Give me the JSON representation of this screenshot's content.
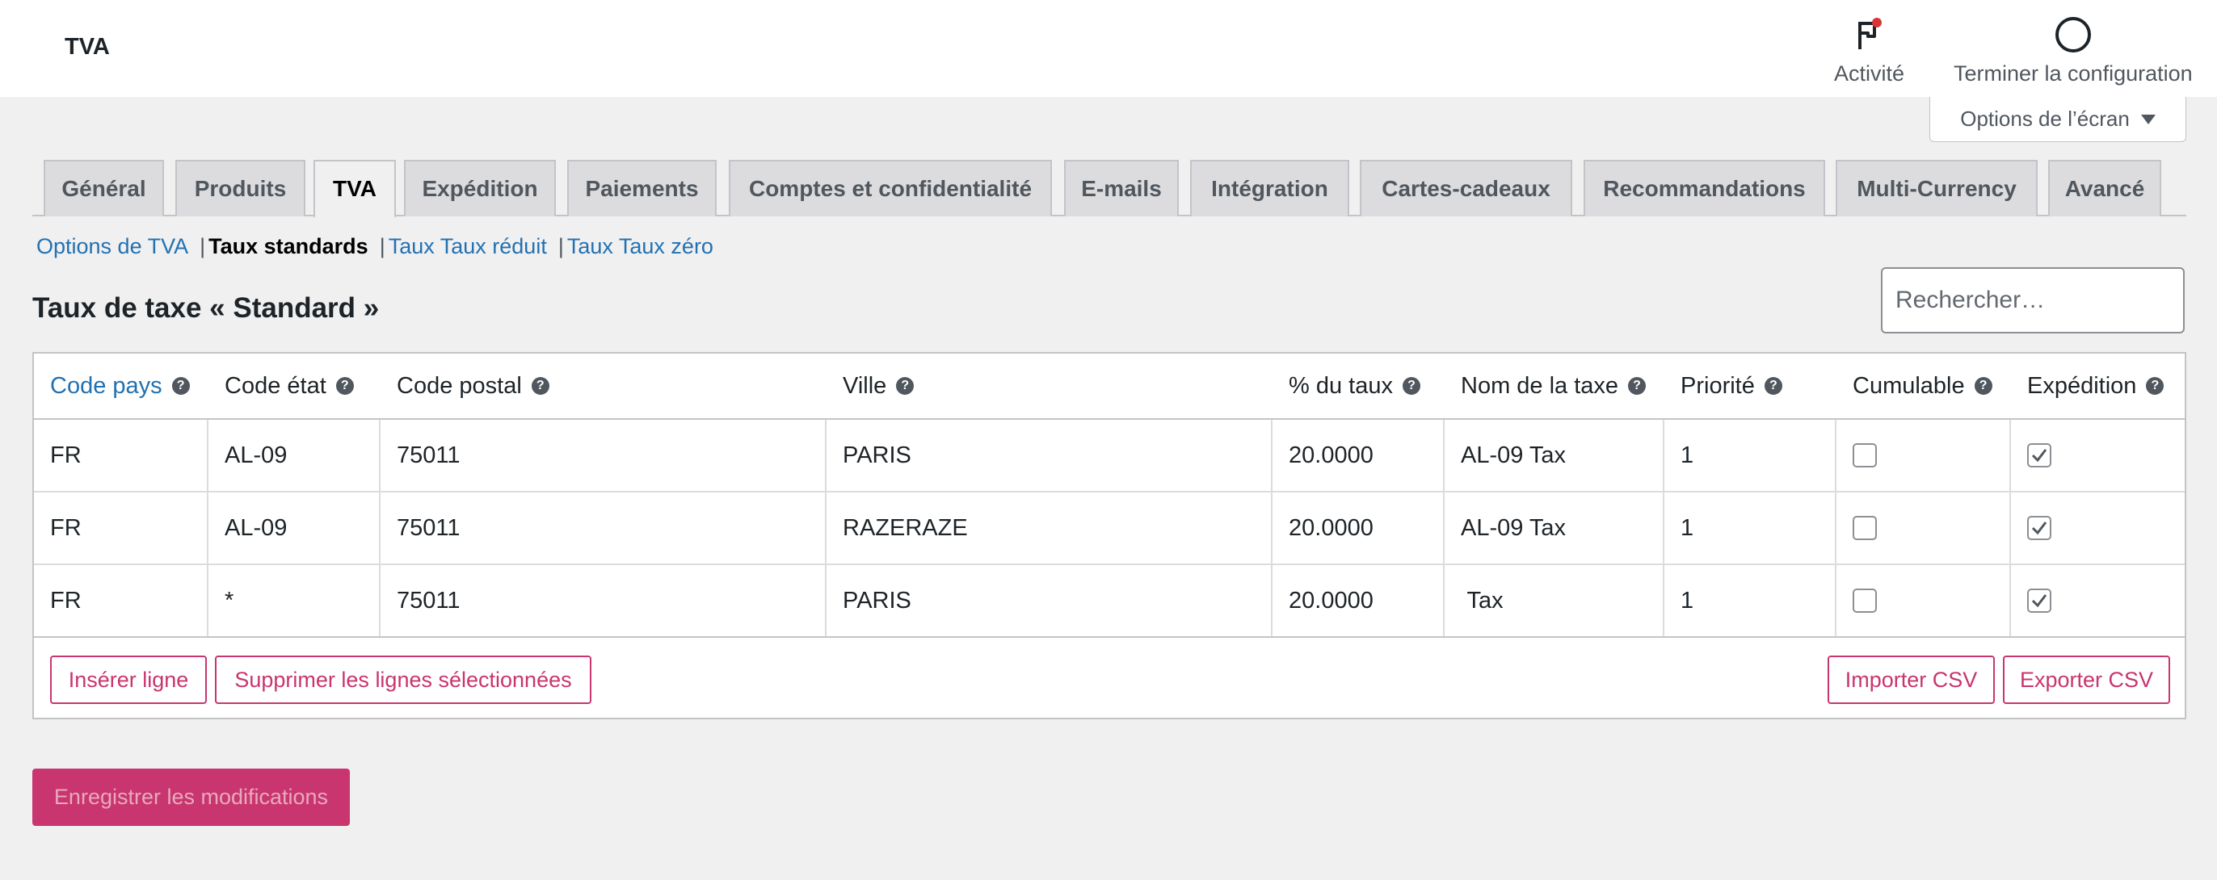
{
  "header": {
    "title": "TVA",
    "activity_label": "Activité",
    "finish_label": "Terminer la configuration"
  },
  "screen_options_label": "Options de l’écran",
  "tabs": [
    {
      "label": "Général"
    },
    {
      "label": "Produits"
    },
    {
      "label": "TVA",
      "active": true
    },
    {
      "label": "Expédition"
    },
    {
      "label": "Paiements"
    },
    {
      "label": "Comptes et confidentialité"
    },
    {
      "label": "E-mails"
    },
    {
      "label": "Intégration"
    },
    {
      "label": "Cartes-cadeaux"
    },
    {
      "label": "Recommandations"
    },
    {
      "label": "Multi-Currency"
    },
    {
      "label": "Avancé"
    }
  ],
  "subnav": [
    {
      "label": "Options de TVA",
      "current": false
    },
    {
      "label": "Taux standards",
      "current": true
    },
    {
      "label": "Taux Taux réduit",
      "current": false
    },
    {
      "label": "Taux Taux zéro",
      "current": false
    }
  ],
  "section_title": "Taux de taxe « Standard »",
  "search": {
    "placeholder": "Rechercher…",
    "value": ""
  },
  "table": {
    "headers": [
      "Code pays",
      "Code état",
      "Code postal",
      "Ville",
      "% du taux",
      "Nom de la taxe",
      "Priorité",
      "Cumulable",
      "Expédition"
    ],
    "help_glyph": "?",
    "rows": [
      {
        "country": "FR",
        "state": "AL-09",
        "postcode": "75011",
        "city": "PARIS",
        "rate": "20.0000",
        "name": "AL-09 Tax",
        "priority": "1",
        "compound": false,
        "shipping": true
      },
      {
        "country": "FR",
        "state": "AL-09",
        "postcode": "75011",
        "city": "RAZERAZE",
        "rate": "20.0000",
        "name": "AL-09 Tax",
        "priority": "1",
        "compound": false,
        "shipping": true
      },
      {
        "country": "FR",
        "state": "*",
        "postcode": "75011",
        "city": "PARIS",
        "rate": "20.0000",
        "name": " Tax",
        "priority": "1",
        "compound": false,
        "shipping": true
      }
    ]
  },
  "actions": {
    "insert": "Insérer ligne",
    "delete": "Supprimer les lignes sélectionnées",
    "import": "Importer CSV",
    "export": "Exporter CSV"
  },
  "save_label": "Enregistrer les modifications",
  "colors": {
    "accent": "#c9356e",
    "link": "#2271b1",
    "notification": "#d63638"
  }
}
